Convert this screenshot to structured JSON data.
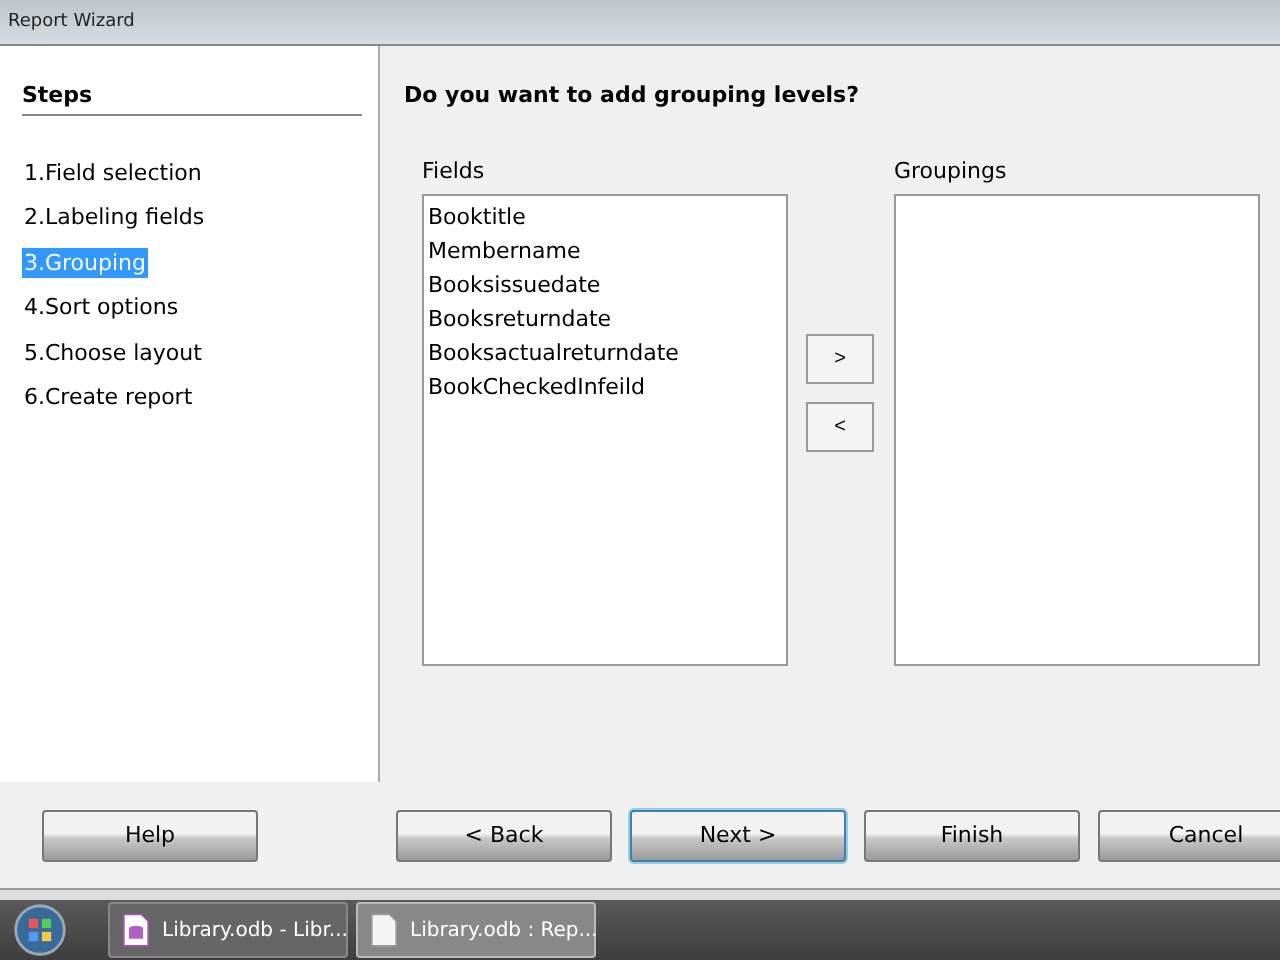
{
  "window": {
    "title": "Report Wizard"
  },
  "steps": {
    "heading": "Steps",
    "items": [
      {
        "label": "1.Field selection",
        "selected": false
      },
      {
        "label": "2.Labeling fields",
        "selected": false
      },
      {
        "label": "3.Grouping",
        "selected": true
      },
      {
        "label": "4.Sort options",
        "selected": false
      },
      {
        "label": "5.Choose layout",
        "selected": false
      },
      {
        "label": "6.Create report",
        "selected": false
      }
    ]
  },
  "question": "Do you want to add grouping levels?",
  "fields": {
    "label": "Fields",
    "items": [
      "Booktitle",
      "Membername",
      "Booksissuedate",
      "Booksreturndate",
      "Booksactualreturndate",
      "BookCheckedInfeild"
    ]
  },
  "move_buttons": [
    ">",
    "<"
  ],
  "groupings": {
    "label": "Groupings"
  },
  "buttons": [
    {
      "label": "Help",
      "focused": false
    },
    {
      "label": "< Back",
      "focused": false
    },
    {
      "label": "Next >",
      "focused": true
    },
    {
      "label": "Finish",
      "focused": false
    },
    {
      "label": "Cancel",
      "focused": false
    }
  ],
  "taskbar": [
    {
      "label": "Library.odb - Libr...",
      "kind": "base",
      "selected": false
    },
    {
      "label": "Library.odb : Rep...",
      "kind": "document",
      "selected": true
    }
  ]
}
